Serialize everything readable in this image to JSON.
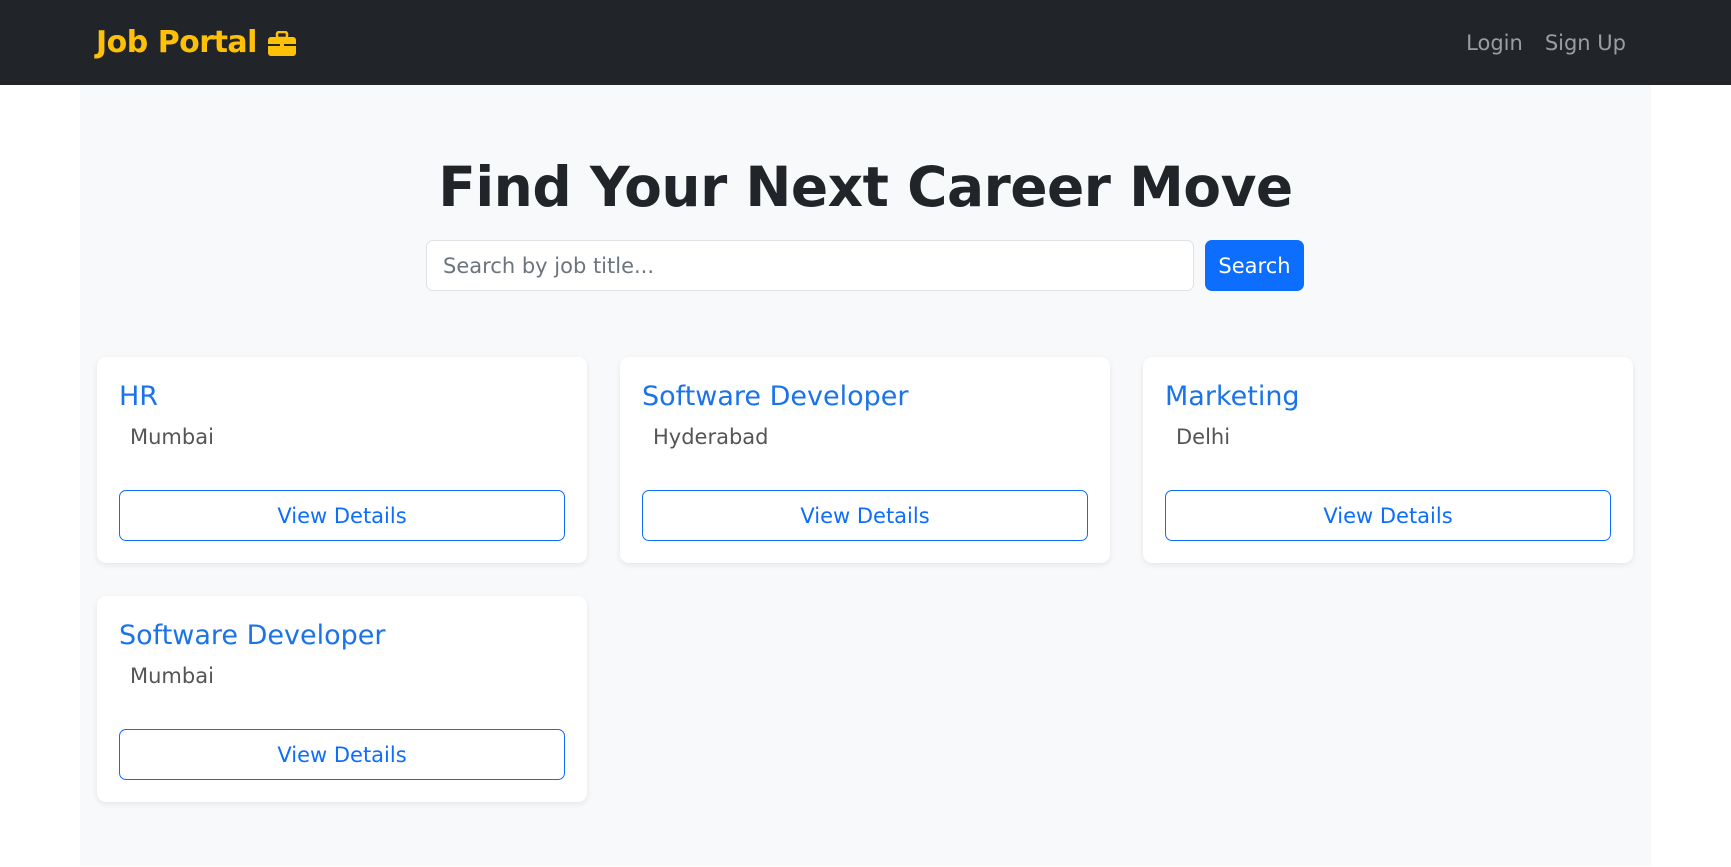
{
  "navbar": {
    "brand": "Job Portal",
    "brand_icon": "briefcase-icon",
    "links": [
      "Login",
      "Sign Up"
    ]
  },
  "hero": {
    "title": "Find Your Next Career Move"
  },
  "search": {
    "placeholder": "Search by job title...",
    "value": "",
    "button_label": "Search"
  },
  "jobs": [
    {
      "title": "HR",
      "location": "Mumbai",
      "button_label": "View Details"
    },
    {
      "title": "Software Developer",
      "location": "Hyderabad",
      "button_label": "View Details"
    },
    {
      "title": "Marketing",
      "location": "Delhi",
      "button_label": "View Details"
    },
    {
      "title": "Software Developer",
      "location": "Mumbai",
      "button_label": "View Details"
    }
  ],
  "colors": {
    "navbar_bg": "#212529",
    "brand": "#ffc107",
    "primary": "#0d6efd",
    "job_title": "#1a73e8",
    "page_bg": "#f8f9fa"
  }
}
